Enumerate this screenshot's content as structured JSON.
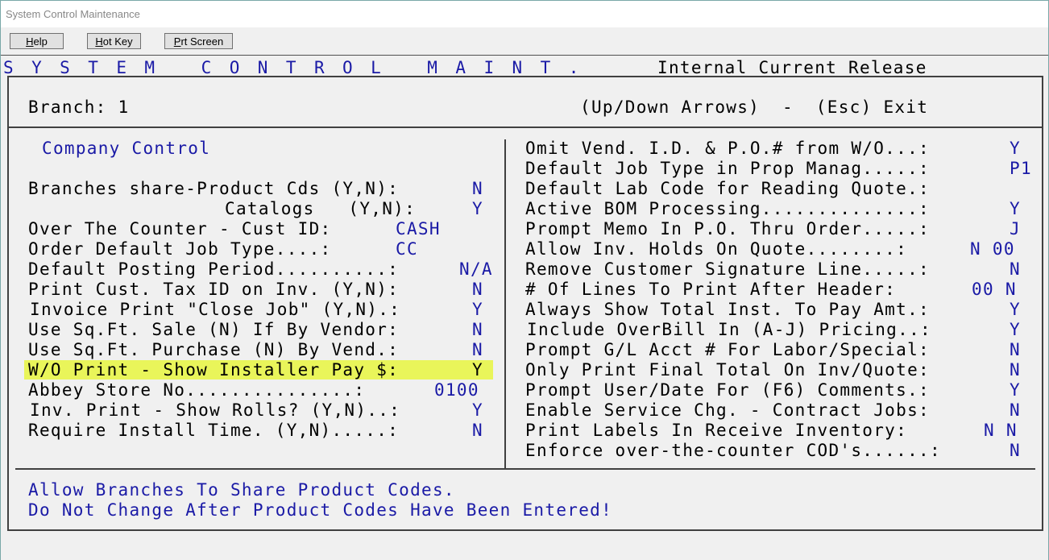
{
  "window": {
    "title": "System Control Maintenance"
  },
  "toolbar": {
    "help": {
      "first": "H",
      "rest": "elp"
    },
    "hotkey": {
      "first": "H",
      "rest": "ot Key"
    },
    "prtscreen": {
      "first": "P",
      "rest": "rt Screen"
    }
  },
  "header": {
    "title": "S Y S T E M   C O N T R O L   M A I N T .",
    "release": "Internal Current Release"
  },
  "branch_bar": {
    "branch": "Branch: 1",
    "help": "(Up/Down Arrows)  -  (Esc) Exit"
  },
  "left": {
    "section_title": "Company Control",
    "rows": [
      {
        "label": "Branches share-Product Cds (Y,N):",
        "value": "N"
      },
      {
        "label": "Catalogs   (Y,N):",
        "value": "Y"
      },
      {
        "label": "Over The Counter - Cust ID:",
        "value": "CASH"
      },
      {
        "label": "Order Default Job Type....:",
        "value": "CC"
      },
      {
        "label": "Default Posting Period..........:",
        "value": "N/A"
      },
      {
        "label": "Print Cust. Tax ID on Inv. (Y,N):",
        "value": "N"
      },
      {
        "label": "Invoice Print \"Close Job\" (Y,N).:",
        "value": "Y"
      },
      {
        "label": "Use Sq.Ft. Sale (N) If By Vendor:",
        "value": "N"
      },
      {
        "label": "Use Sq.Ft. Purchase (N) By Vend.:",
        "value": "N"
      },
      {
        "label": "W/O Print - Show Installer Pay $:",
        "value": "Y"
      },
      {
        "label": "Abbey Store No...............:",
        "value": "0100"
      },
      {
        "label": "Inv. Print - Show Rolls? (Y,N)..:",
        "value": "Y"
      },
      {
        "label": "Require Install Time. (Y,N).....:",
        "value": "N"
      }
    ]
  },
  "right": {
    "rows": [
      {
        "label": "Omit Vend. I.D. & P.O.# from W/O...:",
        "value": "Y"
      },
      {
        "label": "Default Job Type in Prop Manag.....:",
        "value": "P1"
      },
      {
        "label": "Default Lab Code for Reading Quote.:",
        "value": ""
      },
      {
        "label": "Active BOM Processing..............:",
        "value": "Y"
      },
      {
        "label": "Prompt Memo In P.O. Thru Order.....:",
        "value": "J"
      },
      {
        "label": "Allow Inv. Holds On Quote........:",
        "value": "N 00"
      },
      {
        "label": "Remove Customer Signature Line.....:",
        "value": "N"
      },
      {
        "label": "# Of Lines To Print After Header:",
        "value": "00 N"
      },
      {
        "label": "Always Show Total Inst. To Pay Amt.:",
        "value": "Y"
      },
      {
        "label": "Include OverBill In (A-J) Pricing..:",
        "value": "Y"
      },
      {
        "label": "Prompt G/L Acct # For Labor/Special:",
        "value": "N"
      },
      {
        "label": "Only Print Final Total On Inv/Quote:",
        "value": "N"
      },
      {
        "label": "Prompt User/Date For (F6) Comments.:",
        "value": "Y"
      },
      {
        "label": "Enable Service Chg. - Contract Jobs:",
        "value": "N"
      },
      {
        "label": "Print Labels In Receive Inventory:",
        "value": "N N"
      },
      {
        "label": "Enforce over-the-counter COD's......:",
        "value": "N"
      }
    ]
  },
  "footer": {
    "line1": "Allow Branches To Share Product Codes.",
    "line2": "Do Not Change After Product Codes Have Been Entered!"
  },
  "colors": {
    "value_blue": "#1a1aa6",
    "highlight": "#e9f55a"
  }
}
